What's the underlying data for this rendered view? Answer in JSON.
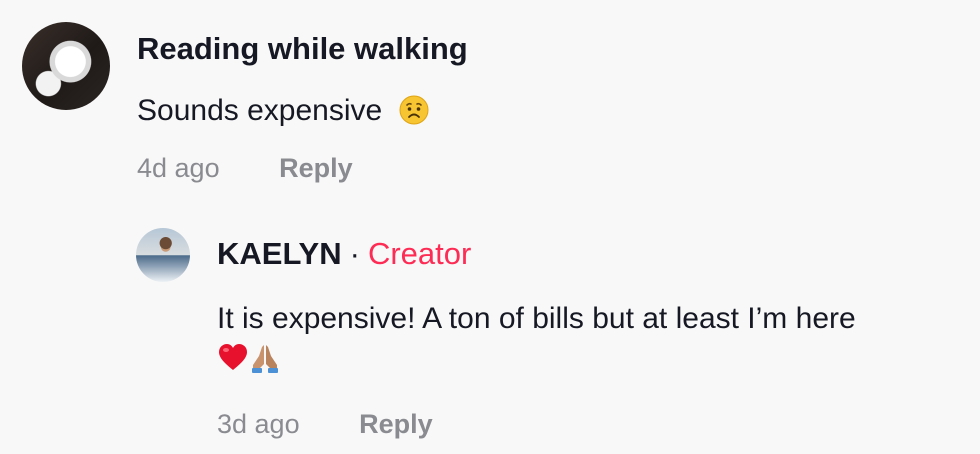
{
  "comments": [
    {
      "username": "Reading while walking",
      "text": "Sounds expensive",
      "emoji": "worried-face-icon",
      "time": "4d ago",
      "reply_label": "Reply"
    }
  ],
  "reply": {
    "username": "KAELYN",
    "separator": "·",
    "badge": "Creator",
    "text": "It is expensive! A ton of bills but at least I’m here",
    "emojis": [
      "red-heart-icon",
      "folded-hands-icon"
    ],
    "time": "3d ago",
    "reply_label": "Reply"
  },
  "colors": {
    "background": "#f8f8f8",
    "text": "#161823",
    "muted": "#8a8b91",
    "creator": "#fe2c55"
  }
}
